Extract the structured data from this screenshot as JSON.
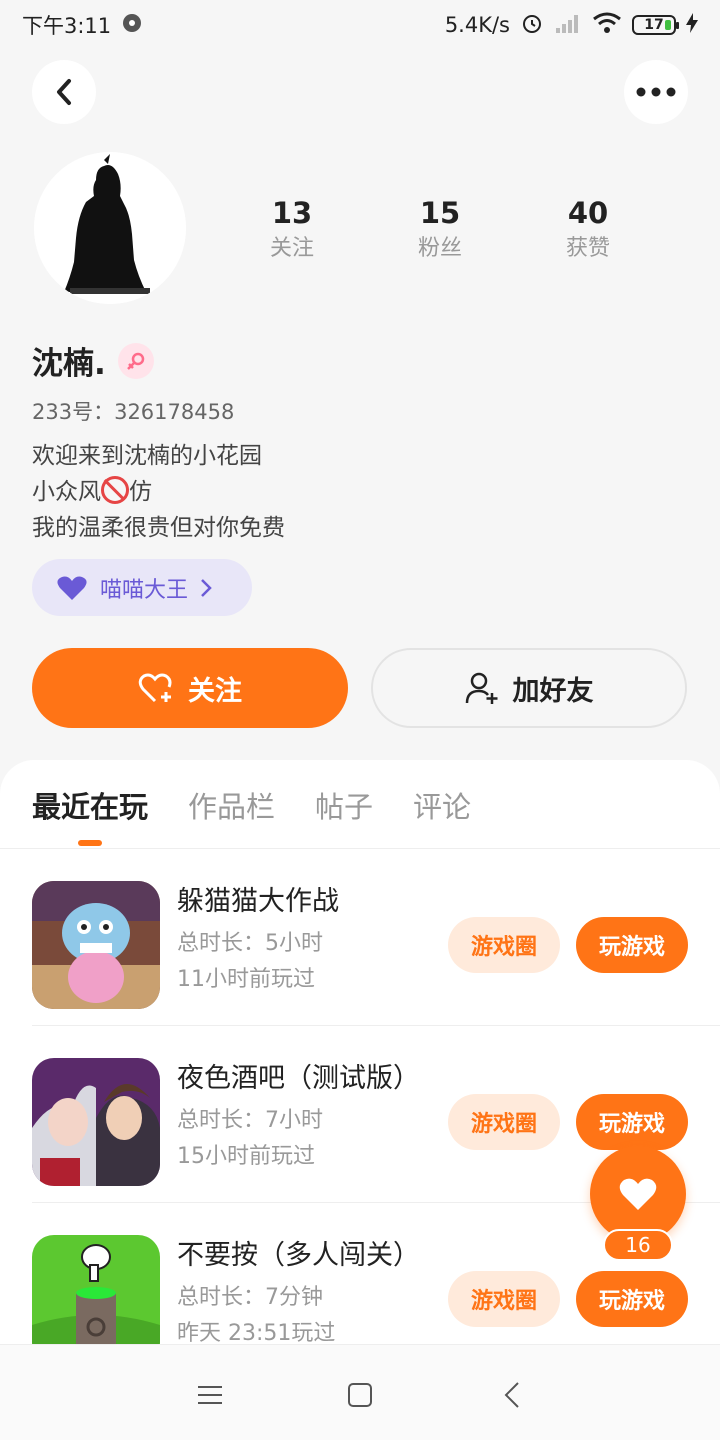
{
  "status_bar": {
    "time": "下午3:11",
    "network_speed": "5.4K/s",
    "battery": "17"
  },
  "profile": {
    "name": "沈楠.",
    "uid": "233号：326178458",
    "bio_lines": [
      "欢迎来到沈楠的小花园",
      "小众风",
      "仿",
      "我的温柔很贵但对你免费"
    ],
    "stats": [
      {
        "value": "13",
        "label": "关注"
      },
      {
        "value": "15",
        "label": "粉丝"
      },
      {
        "value": "40",
        "label": "获赞"
      }
    ],
    "tag": "喵喵大王"
  },
  "actions": {
    "follow": "关注",
    "add_friend": "加好友"
  },
  "tabs": [
    "最近在玩",
    "作品栏",
    "帖子",
    "评论"
  ],
  "games": [
    {
      "title": "躲猫猫大作战",
      "duration": "总时长：5小时",
      "last_played": "11小时前玩过",
      "circle": "游戏圈",
      "play": "玩游戏"
    },
    {
      "title": "夜色酒吧（测试版）",
      "duration": "总时长：7小时",
      "last_played": "15小时前玩过",
      "circle": "游戏圈",
      "play": "玩游戏"
    },
    {
      "title": "不要按（多人闯关）",
      "duration": "总时长：7分钟",
      "last_played": "昨天 23:51玩过",
      "circle": "游戏圈",
      "play": "玩游戏"
    }
  ],
  "like_count": "16",
  "colors": {
    "accent": "#ff7416",
    "tag_bg": "#e8e6f8",
    "tag_text": "#6a5ad6"
  }
}
